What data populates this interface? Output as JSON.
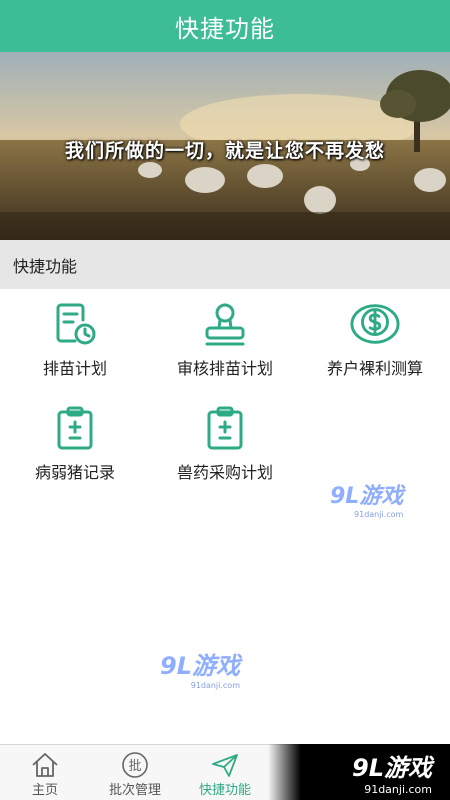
{
  "header": {
    "title": "快捷功能"
  },
  "banner": {
    "caption": "我们所做的一切，就是让您不再发愁"
  },
  "section": {
    "title": "快捷功能"
  },
  "tiles": [
    {
      "label": "排苗计划",
      "icon": "schedule-clock-icon"
    },
    {
      "label": "审核排苗计划",
      "icon": "approval-stamp-icon"
    },
    {
      "label": "养户裸利测算",
      "icon": "dollar-coin-icon"
    },
    {
      "label": "病弱猪记录",
      "icon": "clipboard-plus-minus-icon"
    },
    {
      "label": "兽药采购计划",
      "icon": "clipboard-plus-minus-icon"
    }
  ],
  "watermark": {
    "brand": "9L游戏",
    "site": "91danji.com"
  },
  "tabbar": {
    "items": [
      {
        "label": "主页",
        "icon": "home-icon",
        "active": false
      },
      {
        "label": "批次管理",
        "icon": "batch-icon",
        "active": false
      },
      {
        "label": "快捷功能",
        "icon": "paper-plane-icon",
        "active": true
      }
    ]
  },
  "brand_corner": {
    "brand": "9L游戏",
    "site": "91danji.com"
  },
  "colors": {
    "accent": "#3dbd96",
    "icon_green": "#2eaa84",
    "section_bg": "#e6e6e6"
  }
}
